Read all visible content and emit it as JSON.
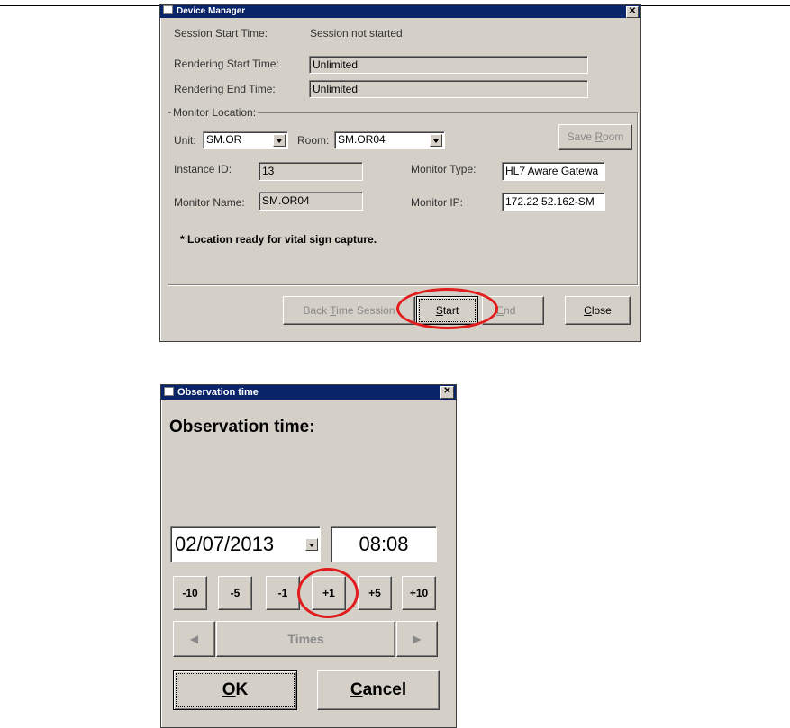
{
  "device_manager": {
    "title": "Device Manager",
    "close_glyph": "✕",
    "session_start_label": "Session Start Time:",
    "session_start_value": "Session not started",
    "rendering_start_label": "Rendering Start Time:",
    "rendering_start_value": "Unlimited",
    "rendering_end_label": "Rendering End Time:",
    "rendering_end_value": "Unlimited",
    "monitor_location_label": "Monitor Location:",
    "unit_label": "Unit:",
    "unit_value": "SM.OR",
    "room_label": "Room:",
    "room_value": "SM.OR04",
    "save_room": {
      "pre": "Save ",
      "accel": "R",
      "post": "oom"
    },
    "instance_id_label": "Instance ID:",
    "instance_id_value": "13",
    "monitor_type_label": "Monitor Type:",
    "monitor_type_value": "HL7 Aware Gatewa",
    "monitor_name_label": "Monitor Name:",
    "monitor_name_value": "SM.OR04",
    "monitor_ip_label": "Monitor IP:",
    "monitor_ip_value": "172.22.52.162-SM",
    "status_message": "*  Location ready for vital sign capture.",
    "back_time_session": {
      "pre": "Back ",
      "accel": "T",
      "post": "ime Session"
    },
    "start": {
      "pre": "",
      "accel": "S",
      "post": "tart"
    },
    "end": {
      "pre": "",
      "accel": "E",
      "post": "nd"
    },
    "close": {
      "pre": "",
      "accel": "C",
      "post": "lose"
    }
  },
  "observation": {
    "title": "Observation time",
    "close_glyph": "✕",
    "heading": "Observation time:",
    "date_value": "02/07/2013",
    "time_value": "08:08",
    "steps": [
      "-10",
      "-5",
      "-1",
      "+1",
      "+5",
      "+10"
    ],
    "prev_glyph": "◀",
    "next_glyph": "▶",
    "times_label": "Times",
    "ok": {
      "pre": "",
      "accel": "O",
      "post": "K"
    },
    "cancel": {
      "pre": "",
      "accel": "C",
      "post": "ancel"
    }
  },
  "highlight_color": "#e21c1c"
}
